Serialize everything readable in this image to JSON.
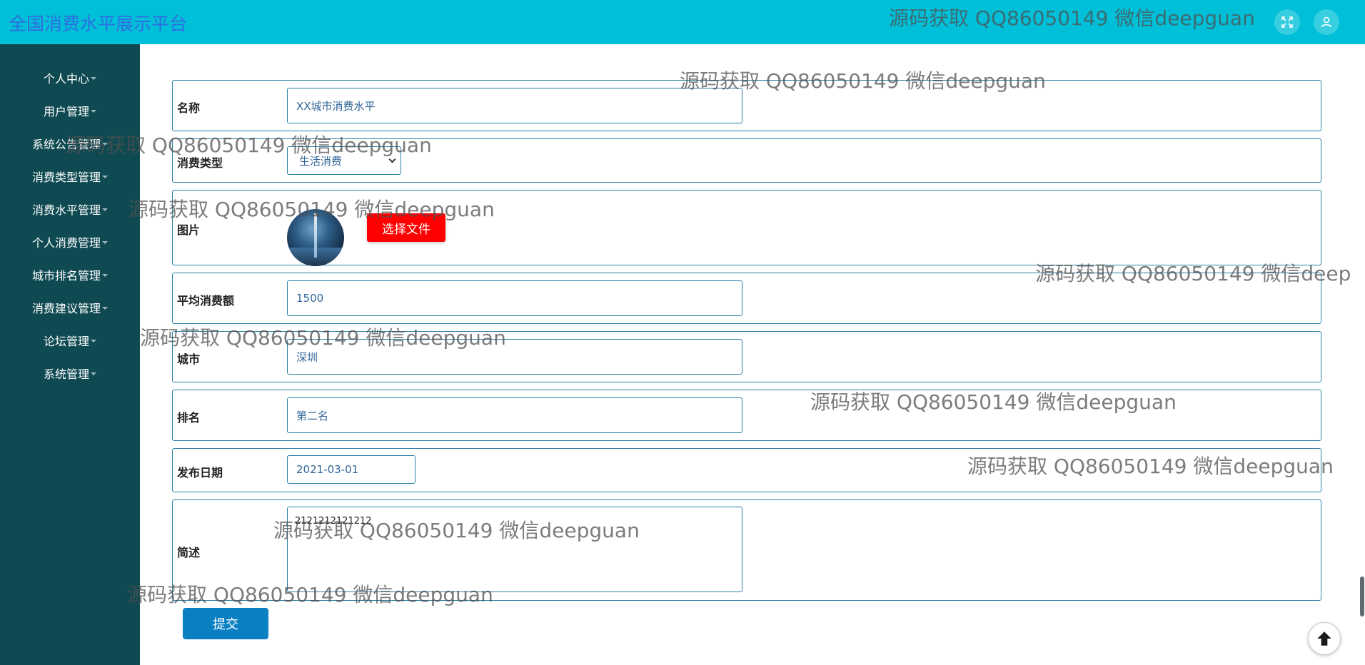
{
  "header": {
    "title": "全国消费水平展示平台",
    "icons": [
      "fullscreen-icon",
      "user-icon"
    ],
    "bg_color": "#00c0d9",
    "title_color": "#2f6de0"
  },
  "sidebar": {
    "bg_color": "#0f4a52",
    "items": [
      {
        "label": "个人中心"
      },
      {
        "label": "用户管理"
      },
      {
        "label": "系统公告管理"
      },
      {
        "label": "消费类型管理"
      },
      {
        "label": "消费水平管理"
      },
      {
        "label": "个人消费管理"
      },
      {
        "label": "城市排名管理"
      },
      {
        "label": "消费建议管理"
      },
      {
        "label": "论坛管理"
      },
      {
        "label": "系统管理"
      }
    ]
  },
  "form": {
    "name": {
      "label": "名称",
      "value": "XX城市消费水平"
    },
    "type": {
      "label": "消费类型",
      "value": "生活消费"
    },
    "image": {
      "label": "图片",
      "button_label": "选择文件",
      "button_color": "#ff0000"
    },
    "avg": {
      "label": "平均消费额",
      "value": "1500"
    },
    "city": {
      "label": "城市",
      "value": "深圳"
    },
    "rank": {
      "label": "排名",
      "value": "第二名"
    },
    "date": {
      "label": "发布日期",
      "value": "2021-03-01"
    },
    "desc": {
      "label": "简述",
      "value": "2121212121212"
    },
    "submit_label": "提交",
    "submit_color": "#0a7fc2"
  },
  "watermarks": [
    "源码获取 QQ86050149 微信deepguan",
    "源码获取 QQ86050149 微信deepguan",
    "源码获取 QQ86050149 微信deepguan",
    "源码获取 QQ86050149 微信deepguan",
    "源码获取 QQ86050149 微信deep",
    "源码获取 QQ86050149 微信deepguan",
    "源码获取 QQ86050149 微信deepguan",
    "源码获取 QQ86050149 微信deepguan",
    "源码获取 QQ86050149 微信deepguan",
    "源码获取 QQ86050149 微信deepguan"
  ]
}
